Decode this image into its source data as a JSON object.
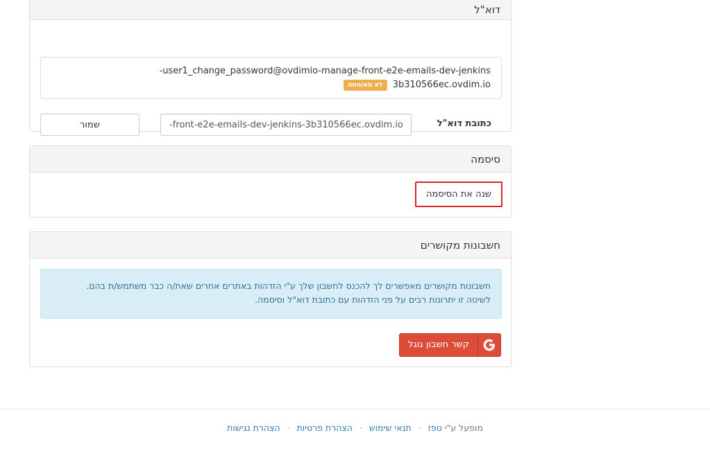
{
  "email_section": {
    "title": "דוא\"ל",
    "current_email_line1": "user1_change_password@ovdimio-manage-front-e2e-emails-dev-jenkins-",
    "current_email_line2": "3b310566ec.ovdim.io",
    "badge_unverified": "לא מאומתת",
    "field_label": "כתובת דוא\"ל",
    "field_value": "-front-e2e-emails-dev-jenkins-3b310566ec.ovdim.io",
    "save_label": "שמור"
  },
  "password_section": {
    "title": "סיסמה",
    "change_label": "שנה את הסיסמה"
  },
  "linked_section": {
    "title": "חשבונות מקושרים",
    "info_line1": "חשבונות מקושרים מאפשרים לך להכנס לחשבון שלך ע\"י הזדהות באתרים אחרים שאת/ה כבר משתמש/ת בהם.",
    "info_line2": "לשיטה זו יתרונות רבים על פני הזדהות עם כתובת דוא\"ל וסיסמה.",
    "google_label": "קשר חשבון גוגל",
    "google_icon": "google-icon"
  },
  "footer": {
    "powered_by": "מופעל ע\"י",
    "brand": "טפז",
    "terms": "תנאי שימוש",
    "privacy": "הצהרת פרטיות",
    "accessibility": "הצהרת נגישות",
    "separator": "·"
  },
  "colors": {
    "accent_red": "#e01f1f",
    "google_red": "#dd4b39",
    "warning_badge": "#f0ad4e",
    "info_bg": "#d9edf7",
    "info_text": "#31708f",
    "link": "#337ab7"
  }
}
